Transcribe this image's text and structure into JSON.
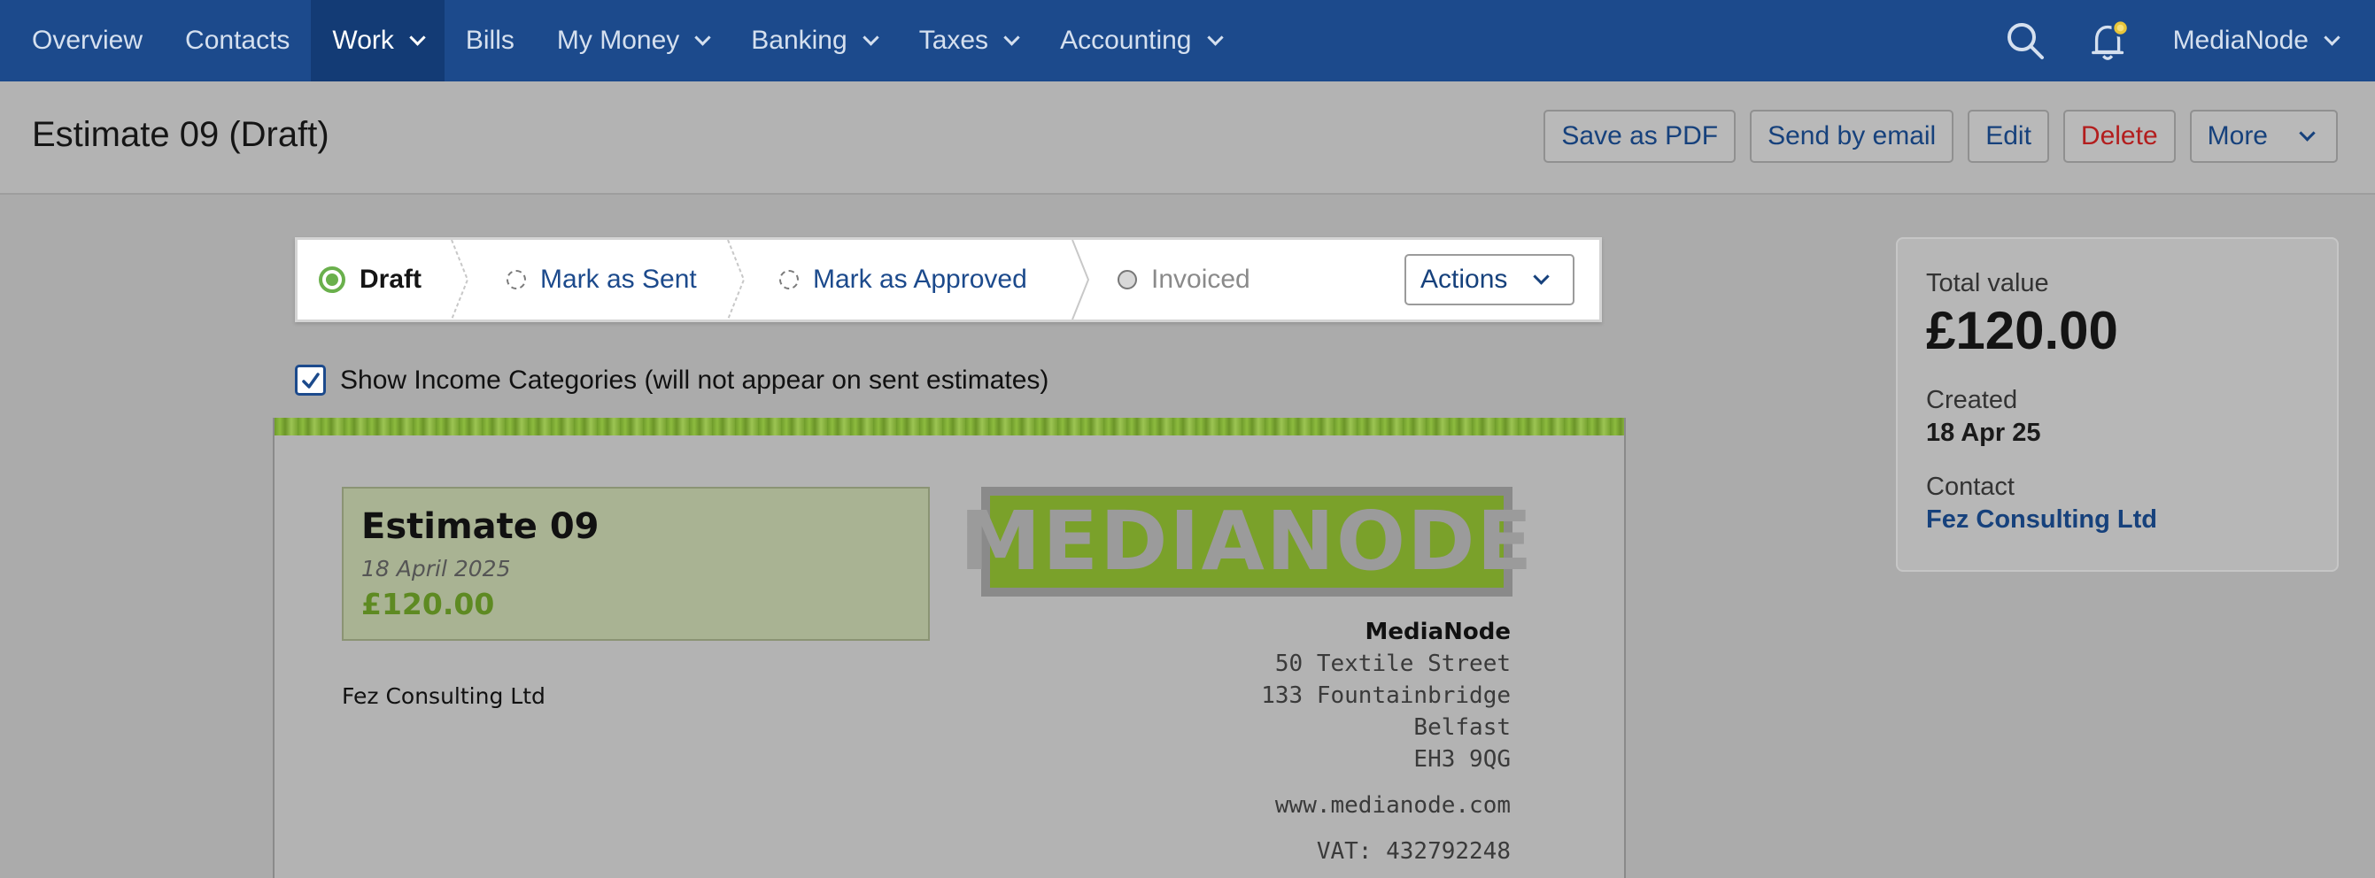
{
  "nav": {
    "items": [
      {
        "label": "Overview",
        "dropdown": false
      },
      {
        "label": "Contacts",
        "dropdown": false
      },
      {
        "label": "Work",
        "dropdown": true,
        "active": true
      },
      {
        "label": "Bills",
        "dropdown": false
      },
      {
        "label": "My Money",
        "dropdown": true
      },
      {
        "label": "Banking",
        "dropdown": true
      },
      {
        "label": "Taxes",
        "dropdown": true
      },
      {
        "label": "Accounting",
        "dropdown": true
      }
    ],
    "account": "MediaNode",
    "icons": [
      "search-icon",
      "bell-icon"
    ]
  },
  "header": {
    "title": "Estimate 09 (Draft)",
    "buttons": {
      "save_pdf": "Save as PDF",
      "send_email": "Send by email",
      "edit": "Edit",
      "delete": "Delete",
      "more": "More"
    }
  },
  "status": {
    "steps": [
      {
        "label": "Draft",
        "state": "done"
      },
      {
        "label": "Mark as Sent",
        "state": "todo"
      },
      {
        "label": "Mark as Approved",
        "state": "todo"
      },
      {
        "label": "Invoiced",
        "state": "disabled"
      }
    ],
    "actions_label": "Actions"
  },
  "categories": {
    "checked": true,
    "label": "Show Income Categories (will not appear on sent estimates)"
  },
  "document": {
    "title": "Estimate 09",
    "date": "18 April 2025",
    "amount": "£120.00",
    "client": "Fez Consulting Ltd",
    "logo_text": "MEDIANODE",
    "company": {
      "name": "MediaNode",
      "address1": "50 Textile Street",
      "address2": "133 Fountainbridge",
      "city": "Belfast",
      "postcode": "EH3 9QG",
      "website": "www.medianode.com",
      "vat": "VAT: 432792248"
    }
  },
  "summary": {
    "total_label": "Total value",
    "total": "£120.00",
    "created_label": "Created",
    "created": "18 Apr 25",
    "contact_label": "Contact",
    "contact": "Fez Consulting Ltd"
  },
  "colors": {
    "nav_bg": "#1c4a8c",
    "accent_green": "#6ab04c",
    "link_blue": "#16417c",
    "danger_red": "#b31d1d"
  }
}
